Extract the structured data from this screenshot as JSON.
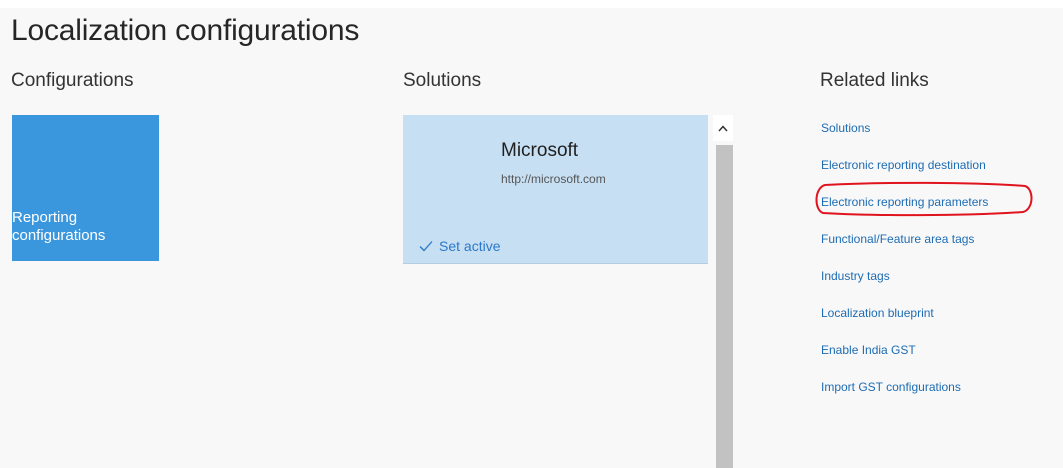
{
  "page": {
    "title": "Localization configurations"
  },
  "sections": {
    "configurations_heading": "Configurations",
    "solutions_heading": "Solutions",
    "related_links_heading": "Related links"
  },
  "configurations": {
    "tile_label": "Reporting configurations",
    "tile_color": "#3a96dd"
  },
  "solutions": {
    "tile": {
      "name": "Microsoft",
      "url": "http://microsoft.com",
      "action_label": "Set active",
      "background_color": "#c7dff3"
    }
  },
  "related_links": {
    "items": [
      "Solutions",
      "Electronic reporting destination",
      "Electronic reporting parameters",
      "Functional/Feature area tags",
      "Industry tags",
      "Localization blueprint",
      "Enable India GST",
      "Import GST configurations"
    ],
    "link_color": "#1d6cb4",
    "highlight_color": "#e0141e",
    "highlighted_item": "Electronic reporting parameters"
  },
  "icons": {
    "check": "check-icon",
    "scroll_up": "chevron-up-icon"
  }
}
